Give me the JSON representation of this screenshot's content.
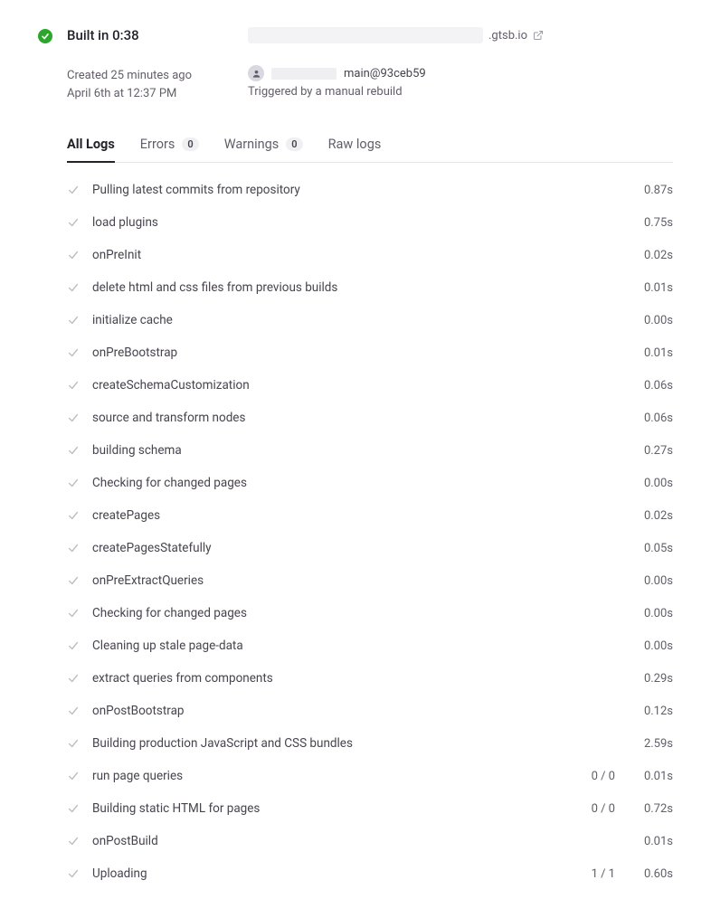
{
  "header": {
    "built_title": "Built in 0:38",
    "created": "Created 25 minutes ago",
    "timestamp": "April 6th at 12:37 PM",
    "url_suffix": ".gtsb.io",
    "commit_ref": "main@93ceb59",
    "trigger": "Triggered by a manual rebuild"
  },
  "tabs": {
    "all_logs": "All Logs",
    "errors": "Errors",
    "errors_count": "0",
    "warnings": "Warnings",
    "warnings_count": "0",
    "raw_logs": "Raw logs"
  },
  "logs": [
    {
      "label": "Pulling latest commits from repository",
      "count": "",
      "time": "0.87s"
    },
    {
      "label": "load plugins",
      "count": "",
      "time": "0.75s"
    },
    {
      "label": "onPreInit",
      "count": "",
      "time": "0.02s"
    },
    {
      "label": "delete html and css files from previous builds",
      "count": "",
      "time": "0.01s"
    },
    {
      "label": "initialize cache",
      "count": "",
      "time": "0.00s"
    },
    {
      "label": "onPreBootstrap",
      "count": "",
      "time": "0.01s"
    },
    {
      "label": "createSchemaCustomization",
      "count": "",
      "time": "0.06s"
    },
    {
      "label": "source and transform nodes",
      "count": "",
      "time": "0.06s"
    },
    {
      "label": "building schema",
      "count": "",
      "time": "0.27s"
    },
    {
      "label": "Checking for changed pages",
      "count": "",
      "time": "0.00s"
    },
    {
      "label": "createPages",
      "count": "",
      "time": "0.02s"
    },
    {
      "label": "createPagesStatefully",
      "count": "",
      "time": "0.05s"
    },
    {
      "label": "onPreExtractQueries",
      "count": "",
      "time": "0.00s"
    },
    {
      "label": "Checking for changed pages",
      "count": "",
      "time": "0.00s"
    },
    {
      "label": "Cleaning up stale page-data",
      "count": "",
      "time": "0.00s"
    },
    {
      "label": "extract queries from components",
      "count": "",
      "time": "0.29s"
    },
    {
      "label": "onPostBootstrap",
      "count": "",
      "time": "0.12s"
    },
    {
      "label": "Building production JavaScript and CSS bundles",
      "count": "",
      "time": "2.59s"
    },
    {
      "label": "run page queries",
      "count": "0 / 0",
      "time": "0.01s"
    },
    {
      "label": "Building static HTML for pages",
      "count": "0 / 0",
      "time": "0.72s"
    },
    {
      "label": "onPostBuild",
      "count": "",
      "time": "0.01s"
    },
    {
      "label": "Uploading",
      "count": "1 / 1",
      "time": "0.60s"
    }
  ]
}
